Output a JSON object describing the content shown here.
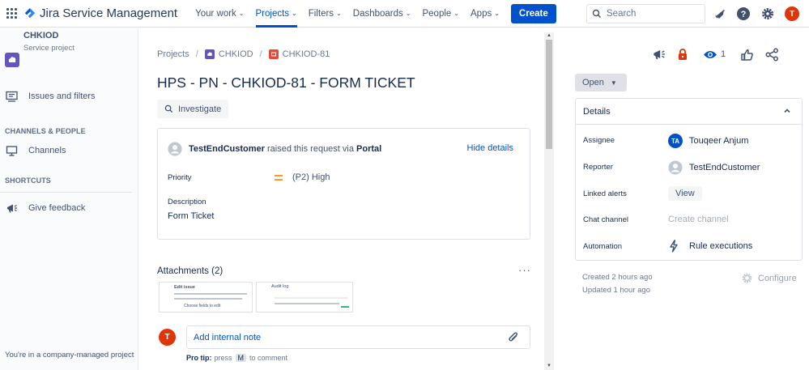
{
  "app": {
    "name": "Jira Service Management",
    "brand_color": "#0052cc"
  },
  "topnav": {
    "items": [
      {
        "label": "Your work",
        "icon": "chevron-down-icon"
      },
      {
        "label": "Projects",
        "icon": "chevron-down-icon",
        "active": true
      },
      {
        "label": "Filters",
        "icon": "chevron-down-icon"
      },
      {
        "label": "Dashboards",
        "icon": "chevron-down-icon"
      },
      {
        "label": "People",
        "icon": "chevron-down-icon"
      },
      {
        "label": "Apps",
        "icon": "chevron-down-icon"
      }
    ],
    "create_label": "Create",
    "search_placeholder": "Search",
    "user_initial": "T"
  },
  "sidebar": {
    "project_name": "CHKIOD",
    "project_type": "Service project",
    "issues_label": "Issues and filters",
    "channels_heading": "CHANNELS & PEOPLE",
    "channels_label": "Channels",
    "shortcuts_heading": "SHORTCUTS",
    "feedback_label": "Give feedback",
    "footer": "You're in a company-managed project"
  },
  "breadcrumb": {
    "root": "Projects",
    "project": "CHKIOD",
    "issue": "CHKIOD-81"
  },
  "issue": {
    "title": "HPS - PN - CHKIOD-81 - FORM TICKET",
    "investigate_label": "Investigate",
    "reporter_name": "TestEndCustomer",
    "raised_text": " raised this request via ",
    "channel": "Portal",
    "hide_details_label": "Hide details",
    "priority_label": "Priority",
    "priority_value": "(P2) High",
    "priority_color": "#ff991f",
    "description_label": "Description",
    "description_value": "Form Ticket"
  },
  "attachments": {
    "title": "Attachments (2)",
    "thumb1_title": "Edit issue",
    "thumb1_caption": "Choose fields to edit",
    "thumb2_title": "Audit log"
  },
  "comment": {
    "user_initial": "T",
    "placeholder": "Add internal note",
    "protip_label": "Pro tip:",
    "protip_press": "press",
    "protip_key": "M",
    "protip_rest": "to comment"
  },
  "right_panel": {
    "watch_count": "1",
    "status": "Open",
    "details_title": "Details",
    "fields": {
      "assignee_label": "Assignee",
      "assignee_initials": "TA",
      "assignee_value": "Touqeer Anjum",
      "reporter_label": "Reporter",
      "reporter_value": "TestEndCustomer",
      "linked_alerts_label": "Linked alerts",
      "linked_alerts_action": "View",
      "chat_channel_label": "Chat channel",
      "chat_channel_action": "Create channel",
      "automation_label": "Automation",
      "automation_value": "Rule executions"
    },
    "created": "Created 2 hours ago",
    "updated": "Updated 1 hour ago",
    "configure_label": "Configure"
  }
}
